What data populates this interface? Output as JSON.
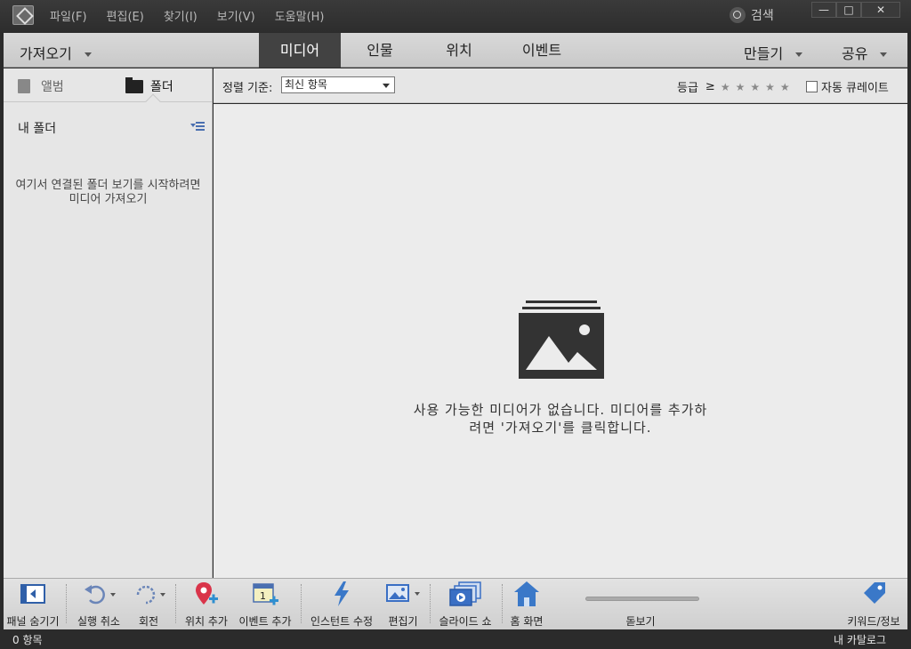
{
  "menu": {
    "items": [
      "파일(F)",
      "편집(E)",
      "찾기(I)",
      "보기(V)",
      "도움말(H)"
    ],
    "search_label": "검색"
  },
  "window_controls": {
    "minimize": "—",
    "maximize": "□",
    "close": "✕"
  },
  "tabbar": {
    "import_label": "가져오기",
    "tabs": [
      {
        "label": "미디어",
        "active": true
      },
      {
        "label": "인물",
        "active": false
      },
      {
        "label": "위치",
        "active": false
      },
      {
        "label": "이벤트",
        "active": false
      }
    ],
    "create_label": "만들기",
    "share_label": "공유"
  },
  "left_panel": {
    "tab_album": "앨범",
    "tab_folder": "폴더",
    "my_folders": "내 폴더",
    "empty_message": "여기서 연결된 폴더 보기를 시작하려면미디어 가져오기"
  },
  "sortbar": {
    "sort_label": "정렬 기준:",
    "sort_value": "최신 항목",
    "rating_label": "등급",
    "rating_operator": "≥",
    "stars": [
      "★",
      "★",
      "★",
      "★",
      "★"
    ],
    "auto_curate_label": "자동 큐레이트"
  },
  "main": {
    "empty_line1": "사용 가능한 미디어가 없습니다. 미디어를 추가하",
    "empty_line2": "려면 '가져오기'를 클릭합니다."
  },
  "toolbar": {
    "hide_panel": "패널 숨기기",
    "undo": "실행 취소",
    "rotate": "회전",
    "add_location": "위치 추가",
    "add_event": "이벤트 추가",
    "instant_fix": "인스턴트 수정",
    "editor": "편집기",
    "slideshow": "슬라이드 쇼",
    "home": "홈 화면",
    "zoom": "돋보기",
    "keyword_info": "키워드/정보"
  },
  "colors": {
    "active_tab_bg": "#424242",
    "accent_blue": "#3a6fc4",
    "location_pin": "#d9344a"
  },
  "status": {
    "item_count": "0 항목",
    "catalog": "내 카탈로그"
  }
}
